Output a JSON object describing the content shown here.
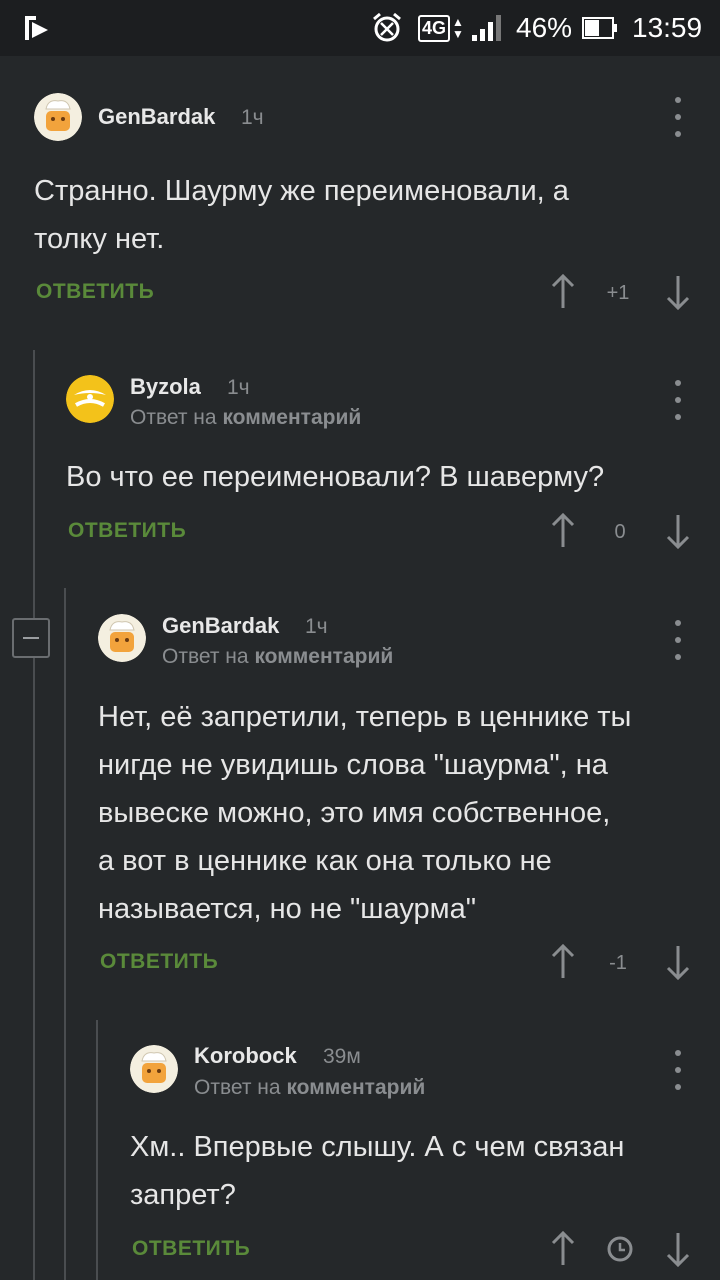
{
  "status_bar": {
    "battery": "46%",
    "time": "13:59",
    "network": "4G",
    "icons": [
      "notification-icon",
      "alarm-icon",
      "signal-icon",
      "battery-icon"
    ]
  },
  "colors": {
    "background": "#25282a",
    "reply_green": "#5a8a3a",
    "muted": "#8a8d90"
  },
  "reply_to_prefix": "Ответ на",
  "reply_to_target": "комментарий",
  "comments": [
    {
      "author": "GenBardak",
      "time": "1ч",
      "text_line1": "Странно. Шаурму же переименовали, а",
      "text_line2": "толку нет.",
      "reply_label": "ОТВЕТИТЬ",
      "score": "+1"
    },
    {
      "author": "Byzola",
      "time": "1ч",
      "text_line1": "Во что ее переименовали? В шаверму?",
      "reply_label": "ОТВЕТИТЬ",
      "score": "0"
    },
    {
      "author": "GenBardak",
      "time": "1ч",
      "text_line1": "Нет, её запретили, теперь в ценнике ты",
      "text_line2": "нигде не увидишь слова \"шаурма\", на",
      "text_line3": "вывеске можно, это имя собственное,",
      "text_line4": "а вот в ценнике как она только не",
      "text_line5": "называется, но не \"шаурма\"",
      "reply_label": "ОТВЕТИТЬ",
      "score": "-1"
    },
    {
      "author": "Korobock",
      "time": "39м",
      "text_line1": "Хм.. Впервые слышу. А с чем связан",
      "text_line2": "запрет?",
      "reply_label": "ОТВЕТИТЬ",
      "score_icon": "clock-icon"
    }
  ]
}
